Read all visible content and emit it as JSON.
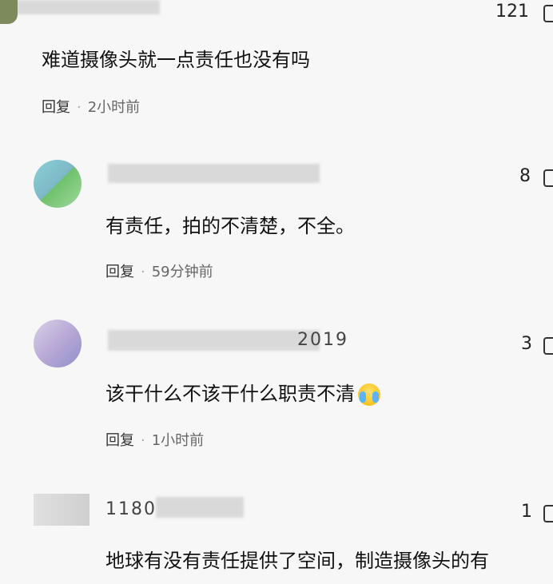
{
  "comments": [
    {
      "id": "c0",
      "text": "难道摄像头就一点责任也没有吗",
      "reply_label": "回复",
      "time": "2小时前",
      "likes": "121"
    },
    {
      "id": "c1",
      "username_partial": "",
      "text": "有责任，拍的不清楚，不全。",
      "reply_label": "回复",
      "time": "59分钟前",
      "likes": "8"
    },
    {
      "id": "c2",
      "username_partial": "2019",
      "text": "该干什么不该干什么职责不清",
      "emoji": "crying-laughing-emoji",
      "reply_label": "回复",
      "time": "1小时前",
      "likes": "3"
    },
    {
      "id": "c3",
      "username_partial": "1180",
      "text_line1": "地球有没有责任提供了空间，制造摄像头的有",
      "likes": "1"
    }
  ],
  "colors": {
    "background": "#f7f7f7",
    "text": "#111111",
    "meta": "#666666"
  }
}
